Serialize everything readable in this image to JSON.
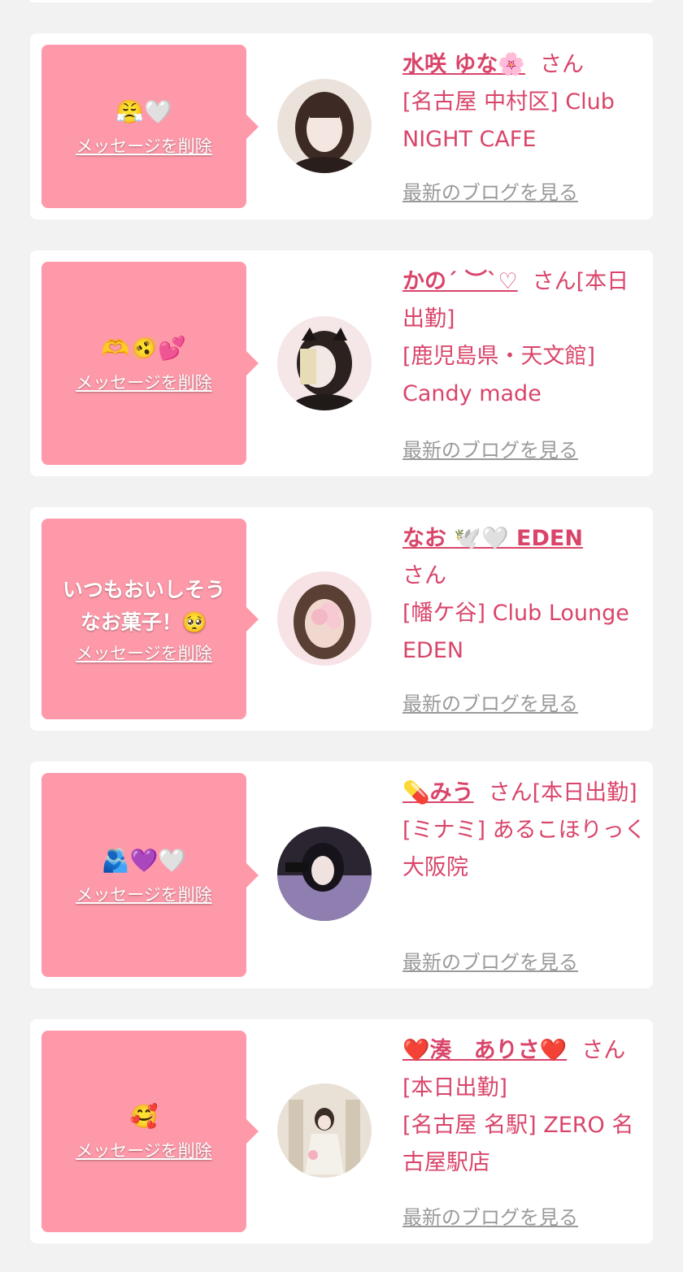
{
  "delete_label": "メッセージを削除",
  "blog_label": "最新のブログを見る",
  "colors": {
    "accent": "#d9456a",
    "bubble": "#fe99a9",
    "card": "#ffffff",
    "background": "#f2f2f2"
  },
  "entries": [
    {
      "message": "",
      "emoji": "😤🤍",
      "name": "水咲 ゆな🌸",
      "honorific": "さん",
      "shop": "[名古屋 中村区] Club NIGHT CAFE",
      "avatar_colors": [
        "#e8dcd6",
        "#3a2a26"
      ]
    },
    {
      "message": "",
      "emoji": "🫶🫨💕",
      "name": "かの´ ︶`♡",
      "honorific": "さん[本日出勤]",
      "shop": "[鹿児島県・天文館] Candy made",
      "avatar_colors": [
        "#f3e4e6",
        "#2b2220"
      ]
    },
    {
      "message": "いつもおいしそうなお菓子！🥺",
      "emoji": "",
      "name": "なお 🕊️🤍 EDEN",
      "honorific": "さん",
      "shop": "[幡ケ谷] Club Lounge EDEN",
      "avatar_colors": [
        "#f6d7d9",
        "#6a4c40"
      ]
    },
    {
      "message": "",
      "emoji": "🫂💜🤍",
      "name": "💊みう",
      "honorific": "さん[本日出勤]",
      "shop": "[ミナミ] あるこほりっく 大阪院",
      "avatar_colors": [
        "#8c7aa6",
        "#1f1a24"
      ]
    },
    {
      "message": "",
      "emoji": "🥰",
      "name": "❤️湊　ありさ❤️",
      "honorific": "さん[本日出勤]",
      "shop": "[名古屋 名駅] ZERO 名古屋駅店",
      "avatar_colors": [
        "#e6ddd2",
        "#a88f7a"
      ]
    }
  ]
}
